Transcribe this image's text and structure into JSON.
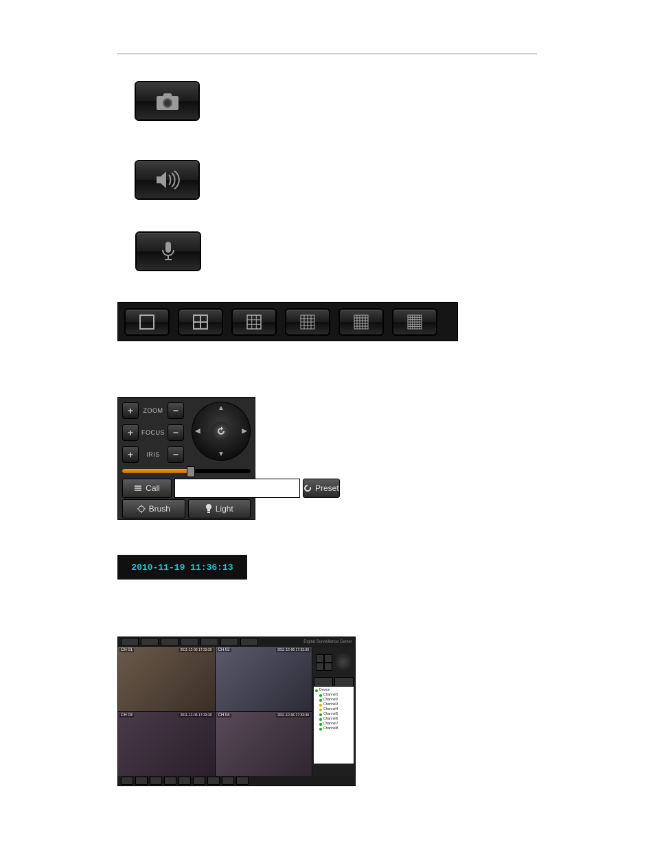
{
  "icons": {
    "camera": "camera-icon",
    "audio": "speaker-icon",
    "mic": "microphone-icon"
  },
  "layout_bar": {
    "options": [
      "1x1",
      "2x2",
      "3x3",
      "4x4",
      "5x5",
      "6x6"
    ]
  },
  "ptz": {
    "controls": [
      {
        "label": "ZOOM"
      },
      {
        "label": "FOCUS"
      },
      {
        "label": "IRIS"
      }
    ],
    "buttons": {
      "call": "Call",
      "preset": "Preset",
      "brush": "Brush",
      "light": "Light"
    },
    "preset_value": ""
  },
  "timestamp": "2010-11-19 11:36:13",
  "surveillance": {
    "title": "Digital Surveillance Center",
    "top_tabs": [
      "",
      "",
      "",
      "",
      "",
      "",
      ""
    ],
    "cams": [
      {
        "ch": "CH 01",
        "ts": "2011-12-06 17:33:30"
      },
      {
        "ch": "CH 02",
        "ts": "2011-12-06 17:33:30"
      },
      {
        "ch": "CH 03",
        "ts": "2011-12-06 17:33:30"
      },
      {
        "ch": "CH 04",
        "ts": "2011-12-06 17:33:30"
      }
    ],
    "tree": [
      {
        "name": "Device",
        "color": "g"
      },
      {
        "name": "Channel1",
        "color": "g"
      },
      {
        "name": "Channel2",
        "color": "g"
      },
      {
        "name": "Channel3",
        "color": "y"
      },
      {
        "name": "Channel4",
        "color": "y"
      },
      {
        "name": "Channel5",
        "color": "g"
      },
      {
        "name": "Channel6",
        "color": "g"
      },
      {
        "name": "Channel7",
        "color": "g"
      },
      {
        "name": "Channel8",
        "color": "g"
      }
    ],
    "bottom_btn_count": 9
  }
}
